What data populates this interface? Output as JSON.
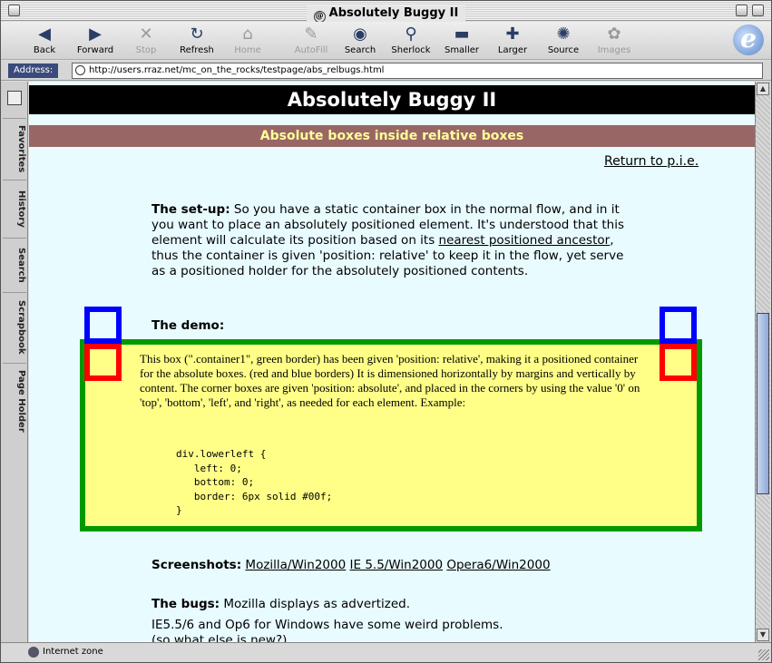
{
  "window": {
    "title": "Absolutely Buggy II"
  },
  "toolbar": {
    "buttons": [
      {
        "label": "Back",
        "icon": "back-arrow-icon",
        "glyph": "◀"
      },
      {
        "label": "Forward",
        "icon": "forward-arrow-icon",
        "glyph": "▶"
      },
      {
        "label": "Stop",
        "icon": "stop-icon",
        "glyph": "✕"
      },
      {
        "label": "Refresh",
        "icon": "refresh-icon",
        "glyph": "↻"
      },
      {
        "label": "Home",
        "icon": "home-icon",
        "glyph": "⌂"
      },
      {
        "label": "AutoFill",
        "icon": "autofill-icon",
        "glyph": "✎"
      },
      {
        "label": "Search",
        "icon": "search-eye-icon",
        "glyph": "◉"
      },
      {
        "label": "Sherlock",
        "icon": "sherlock-icon",
        "glyph": "⚲"
      },
      {
        "label": "Smaller",
        "icon": "smaller-icon",
        "glyph": "▬"
      },
      {
        "label": "Larger",
        "icon": "larger-icon",
        "glyph": "✚"
      },
      {
        "label": "Source",
        "icon": "source-icon",
        "glyph": "✺"
      },
      {
        "label": "Images",
        "icon": "images-icon",
        "glyph": "✿"
      }
    ]
  },
  "address": {
    "label": "Address:",
    "url": "http://users.rraz.net/mc_on_the_rocks/testpage/abs_relbugs.html"
  },
  "sidetabs": [
    "Favorites",
    "History",
    "Search",
    "Scrapbook",
    "Page Holder"
  ],
  "page": {
    "title": "Absolutely Buggy II",
    "subtitle": "Absolute boxes inside relative boxes",
    "return_link": "Return to p.i.e.",
    "setup_label": "The set-up:",
    "setup_text_1": " So you have a static container box in the normal flow, and in it you want to place an absolutely positioned element. It's understood that this element will calculate its position based on its ",
    "setup_link": "nearest positioned ancestor",
    "setup_text_2": ", thus the container is given 'position: relative' to keep it in the flow, yet serve as a positioned holder for the absolutely positioned contents.",
    "demo_label": "The demo:",
    "demo_text": "This box (\".container1\", green border) has been given 'position: relative', making it a positioned container for the absolute boxes. (red and blue borders) It is dimensioned horizontally by margins and vertically by content. The corner boxes are given 'position: absolute', and placed in the corners by using the value '0' on 'top', 'bottom', 'left', and 'right', as needed for each element. Example:",
    "code": "div.lowerleft {\n   left: 0;\n   bottom: 0;\n   border: 6px solid #00f;\n}",
    "screenshots_label": "Screenshots:",
    "screenshot_links": [
      "Mozilla/Win2000",
      "IE 5.5/Win2000",
      "Opera6/Win2000"
    ],
    "bugs_label": "The bugs:",
    "bugs_text": " Mozilla displays as advertized.",
    "bugs_text_2": "IE5.5/6 and Op6 for Windows have some weird problems.",
    "bugs_text_3": "(so what else is new?)"
  },
  "status": {
    "zone": "Internet zone"
  },
  "colors": {
    "page_bg": "#e8fbff",
    "subtitle_bg": "#996666",
    "subtitle_fg": "#ffff99",
    "container_bg": "#ffff88",
    "container_border": "#009900",
    "box_blue": "#0000ff",
    "box_red": "#ff0000"
  }
}
